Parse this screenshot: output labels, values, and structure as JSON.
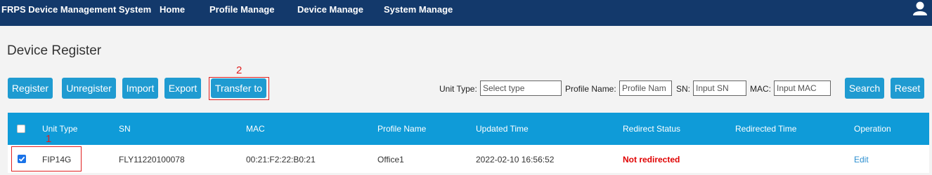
{
  "header": {
    "brand": "FRPS Device Management System",
    "nav": [
      "Home",
      "Profile Manage",
      "Device Manage",
      "System Manage"
    ]
  },
  "page_title": "Device Register",
  "toolbar": {
    "register": "Register",
    "unregister": "Unregister",
    "import": "Import",
    "export": "Export",
    "transfer": "Transfer to"
  },
  "filters": {
    "unit_type_label": "Unit Type:",
    "unit_type_placeholder": "Select type",
    "profile_name_label": "Profile Name:",
    "profile_name_placeholder": "Profile Nam",
    "sn_label": "SN:",
    "sn_placeholder": "Input SN",
    "mac_label": "MAC:",
    "mac_placeholder": "Input MAC",
    "search": "Search",
    "reset": "Reset"
  },
  "table": {
    "columns": [
      "Unit Type",
      "SN",
      "MAC",
      "Profile Name",
      "Updated Time",
      "Redirect Status",
      "Redirected Time",
      "Operation"
    ],
    "rows": [
      {
        "checked": true,
        "unit_type": "FIP14G",
        "sn": "FLY11220100078",
        "mac": "00:21:F2:22:B0:21",
        "profile_name": "Office1",
        "updated_time": "2022-02-10 16:56:52",
        "redirect_status": "Not redirected",
        "redirected_time": "",
        "operation": "Edit"
      }
    ]
  },
  "annotations": {
    "first": "1",
    "second": "2"
  },
  "colors": {
    "topbar": "#13396b",
    "button": "#1f9bd1",
    "table_header": "#0f9bd8",
    "status_red": "#e00000",
    "annotation": "#e02020"
  }
}
